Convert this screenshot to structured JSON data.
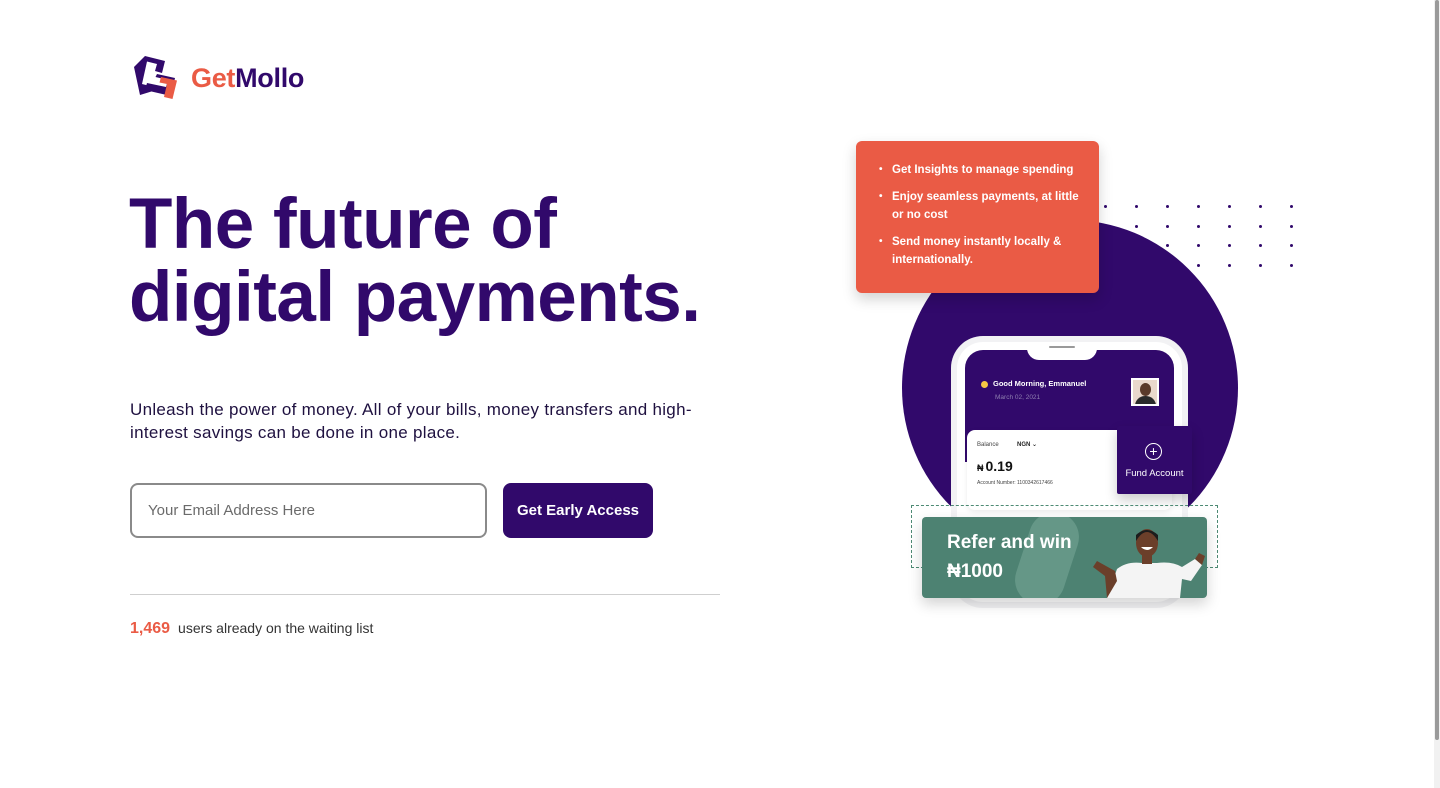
{
  "brand": {
    "name_part1": "Get",
    "name_part2": "Mollo"
  },
  "hero": {
    "title_line1": "The future of",
    "title_line2": "digital payments.",
    "subtitle": "Unleash the power of money. All of your bills, money transfers and high-interest savings can be done in one place."
  },
  "signup": {
    "email_placeholder": "Your Email Address Here",
    "email_value": "",
    "button_label": "Get Early Access"
  },
  "waitlist": {
    "count": "1,469",
    "text": "users already on the waiting list"
  },
  "illustration": {
    "features": [
      "Get Insights to manage spending",
      "Enjoy seamless payments, at little or no cost",
      "Send money instantly locally & internationally."
    ],
    "phone": {
      "greeting": "Good Morning, Emmanuel",
      "date": "March 02, 2021",
      "balance_label": "Balance",
      "currency": "NGN",
      "currency_symbol": "₦",
      "balance": "0.19",
      "account_number": "Account Number: 1100342617466"
    },
    "fund_account_label": "Fund Account",
    "refer": {
      "title": "Refer and win",
      "amount": "₦1000"
    }
  },
  "colors": {
    "brand_purple": "#31096b",
    "brand_orange": "#ea5b45",
    "refer_green": "#4d8272"
  }
}
